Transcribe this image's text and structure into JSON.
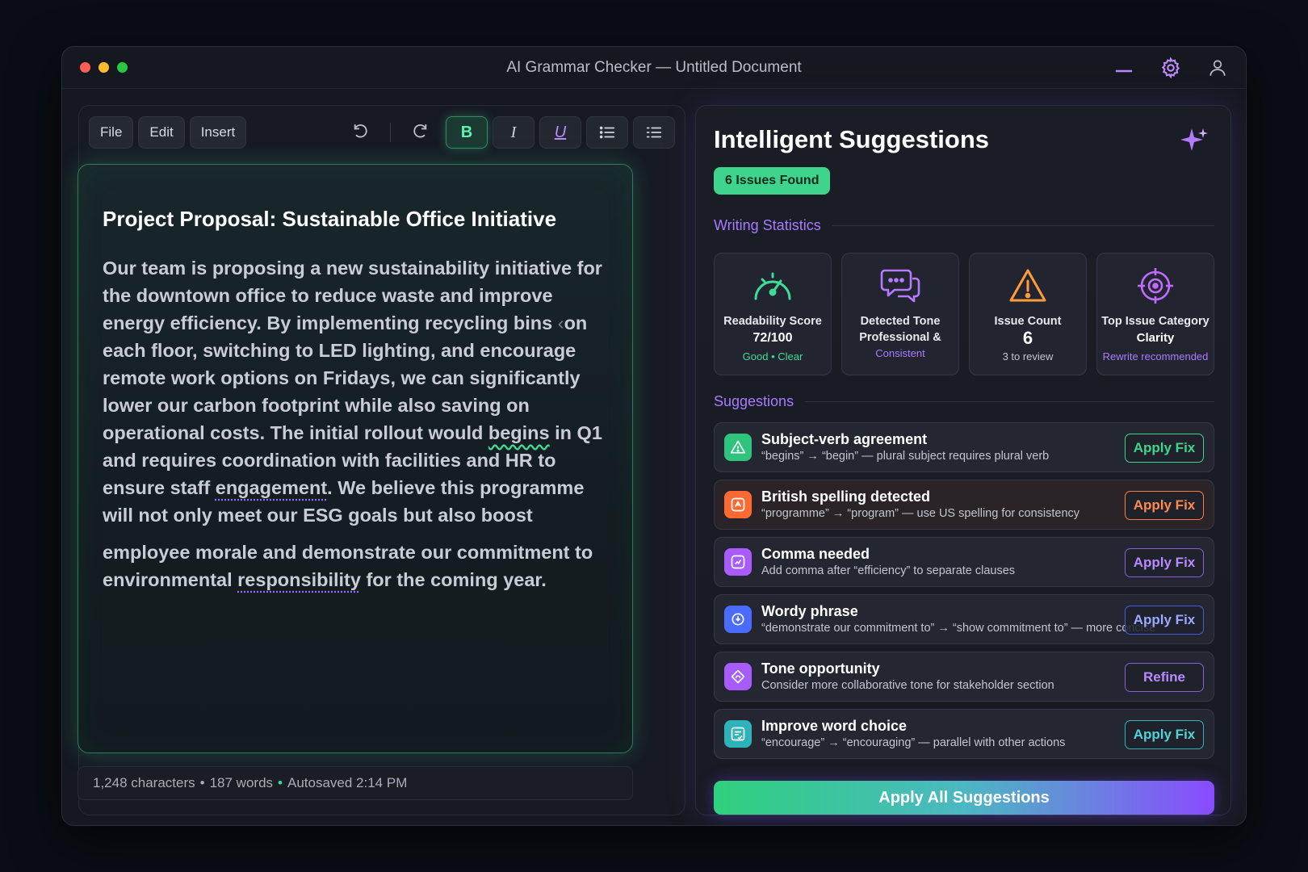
{
  "window": {
    "title": "AI Grammar Checker — Untitled Document"
  },
  "toolbar": {
    "menus": [
      "File",
      "Edit",
      "Insert"
    ],
    "bold": "B",
    "italic": "I",
    "underline": "U"
  },
  "document": {
    "title": "Project Proposal: Sustainable Office Initiative",
    "p1_a": "Our team is proposing a new sustainability initiative for the downtown office to reduce waste and improve energy efficiency. By implementing recycling bins ",
    "p1_caret": "‹",
    "p1_b": "on each floor, switching to LED lighting, and encourage remote work options on Fridays, we can significantly lower our carbon footprint while also saving on operational costs. The initial rollout would ",
    "p1_err1": "begins",
    "p1_c": " in Q1 and requires coordination with facilities and HR to ensure staff ",
    "p1_err2": "engagement",
    "p1_d": ". We believe this programme will not only meet our ESG goals but also boost",
    "p2_a": "employee morale and demonstrate our commitment to environmental ",
    "p2_err": "responsibility",
    "p2_b": " for the coming year."
  },
  "status": {
    "characters": "1,248 characters",
    "sep": "•",
    "words": "187 words",
    "autosave": "Autosaved 2:14 PM"
  },
  "panel": {
    "title": "Intelligent Suggestions",
    "issues_badge": "6 Issues Found",
    "stats_label": "Writing Statistics",
    "suggestions_label": "Suggestions",
    "apply_all": "Apply All Suggestions"
  },
  "stats": [
    {
      "label": "Readability Score",
      "value": "72/100",
      "sub": "Good • Clear",
      "sub_color": "#3ddc97",
      "icon": "gauge-icon"
    },
    {
      "label": "Detected Tone",
      "value": "Professional &",
      "sub": "Consistent",
      "sub_color": "#a77bff",
      "icon": "chat-bubbles-icon"
    },
    {
      "label": "Issue Count",
      "value": "6",
      "sub": "3 to review",
      "sub_color": "#c2c5ce",
      "icon": "warning-icon"
    },
    {
      "label": "Top Issue Category",
      "value": "Clarity",
      "sub": "Rewrite recommended",
      "sub_color": "#a77bff",
      "icon": "target-icon"
    }
  ],
  "suggestions": [
    {
      "title": "Subject-verb agreement",
      "desc": "“begins” → “begin” — plural subject requires plural verb",
      "action": "Apply Fix",
      "color": "#3fd48d",
      "icon": "alert-triangle-icon"
    },
    {
      "title": "British spelling detected",
      "desc": "“programme” → “program” — use US spelling for consistency",
      "action": "Apply Fix",
      "color": "#ff7a3d",
      "icon": "spell-icon"
    },
    {
      "title": "Comma needed",
      "desc": "Add comma after “efficiency” to separate clauses",
      "action": "Apply Fix",
      "color": "#b06bff",
      "icon": "punctuation-icon"
    },
    {
      "title": "Wordy phrase",
      "desc": "“demonstrate our commitment to” → “show commitment to” — more concise",
      "action": "Apply Fix",
      "color": "#5a7bff",
      "icon": "compress-icon"
    },
    {
      "title": "Tone opportunity",
      "desc": "Consider more collaborative tone for stakeholder section",
      "action": "Refine",
      "color": "#b06bff",
      "icon": "tone-icon"
    },
    {
      "title": "Improve word choice",
      "desc": "“encourage” → “encouraging” — parallel with other actions",
      "action": "Apply Fix",
      "color": "#37c2c9",
      "icon": "word-icon"
    }
  ]
}
